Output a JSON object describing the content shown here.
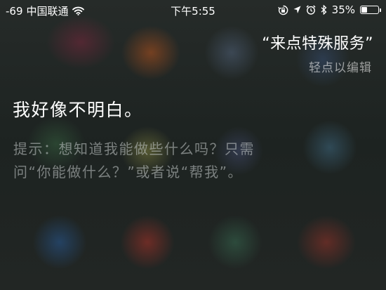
{
  "status_bar": {
    "signal": "-69",
    "carrier": "中国联通",
    "time": "下午5:55",
    "battery_percent": "35%",
    "battery_level": 0.35,
    "icons": [
      "wifi-icon",
      "rotation-lock-icon",
      "location-arrow-icon",
      "alarm-clock-icon",
      "bluetooth-icon",
      "battery-icon"
    ]
  },
  "siri": {
    "query": "“来点特殊服务”",
    "tap_to_edit": "轻点以编辑",
    "response": "我好像不明白。",
    "hint_line1": "提示：想知道我能做些什么吗？只需",
    "hint_line2": "问“你能做什么？”或者说“帮我”。"
  }
}
